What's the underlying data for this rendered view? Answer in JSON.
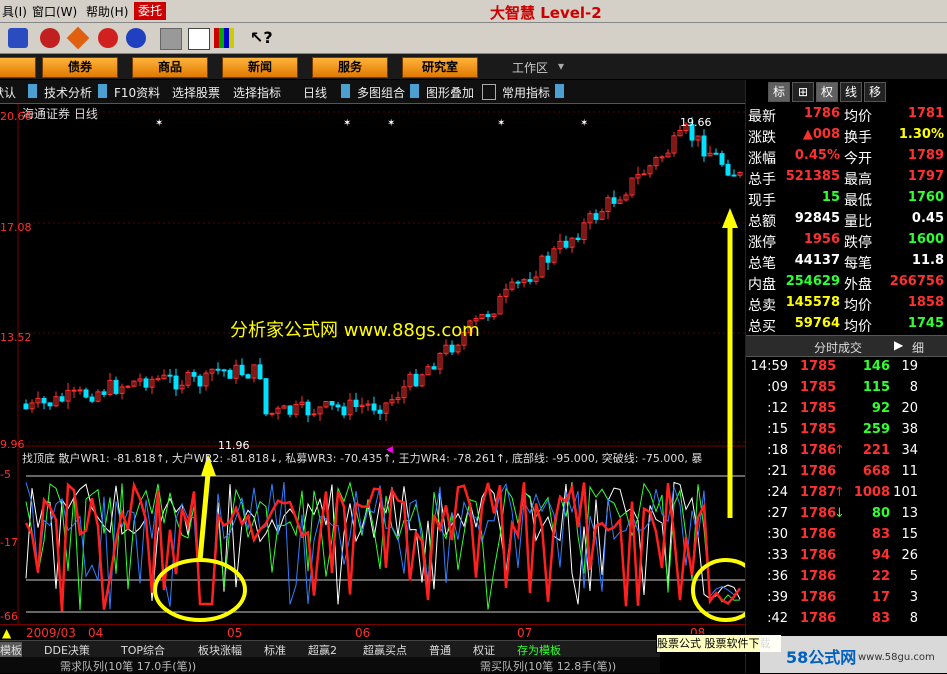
{
  "menu": {
    "items": [
      "具(I)",
      "窗口(W)",
      "帮助(H)"
    ],
    "entrust": "委托"
  },
  "brand": {
    "title": "大智慧 Level-2"
  },
  "nav": {
    "buttons": [
      "债券",
      "商品",
      "新闻",
      "服务",
      "研究室"
    ],
    "workarea": "工作区"
  },
  "funcbar": {
    "items": [
      "默认",
      "技术分析",
      "F10资料",
      "选择股票",
      "选择指标",
      "日线",
      "多图组合",
      "图形叠加",
      "常用指标"
    ]
  },
  "chart": {
    "header": "海通证券 日线",
    "price_levels": [
      "20.66",
      "17.08",
      "13.52",
      "9.96"
    ],
    "high_label": "19.66",
    "low_label": "11.96",
    "watermark": "分析家公式网 www.88gs.com",
    "indicator_line": "找顶底 散户WR1: -81.818↑, 大户WR2: -81.818↓, 私募WR3: -70.435↑, 王力WR4: -78.261↑, 底部线: -95.000, 突破线: -75.000, 暴",
    "indicator_levels": [
      "-5",
      "-17",
      "-66"
    ],
    "date_labels": [
      "2009/03",
      "04",
      "05",
      "06",
      "07",
      "08"
    ]
  },
  "chart_data": {
    "type": "line",
    "title": "海通证券 日线",
    "price_high": 19.66,
    "price_low": 11.96,
    "indicator_params": {
      "WR1": -81.818,
      "WR2": -81.818,
      "WR3": -70.435,
      "WR4": -78.261,
      "bottom_line": -95.0,
      "breakout_line": -75.0
    }
  },
  "right_panel": {
    "tabs": [
      "标",
      "⊞",
      "权",
      "线",
      "移"
    ],
    "quotes": [
      {
        "k1": "最新",
        "v1": "1786",
        "k2": "均价",
        "v2": "1781"
      },
      {
        "k1": "涨跌",
        "v1": "▲008",
        "k2": "换手",
        "v2": "1.30%"
      },
      {
        "k1": "涨幅",
        "v1": "0.45%",
        "k2": "今开",
        "v2": "1789"
      },
      {
        "k1": "总手",
        "v1": "521385",
        "k2": "最高",
        "v2": "1797"
      },
      {
        "k1": "现手",
        "v1": "15",
        "k2": "最低",
        "v2": "1760"
      },
      {
        "k1": "总额",
        "v1": "92845",
        "k2": "量比",
        "v2": "0.45"
      },
      {
        "k1": "涨停",
        "v1": "1956",
        "k2": "跌停",
        "v2": "1600"
      },
      {
        "k1": "总笔",
        "v1": "44137",
        "k2": "每笔",
        "v2": "11.8"
      },
      {
        "k1": "内盘",
        "v1": "254629",
        "k2": "外盘",
        "v2": "266756"
      },
      {
        "k1": "总卖",
        "v1": "145578",
        "k2": "均价",
        "v2": "1858"
      },
      {
        "k1": "总买",
        "v1": "59764",
        "k2": "均价",
        "v2": "1745"
      }
    ],
    "ticks_title": "分时成交",
    "ticks_detail": "细",
    "ticks": [
      {
        "t": "14:59",
        "p": "1785",
        "arr": "",
        "v": "146",
        "n": "19"
      },
      {
        "t": ":09",
        "p": "1785",
        "arr": "",
        "v": "115",
        "n": "8"
      },
      {
        "t": ":12",
        "p": "1785",
        "arr": "",
        "v": "92",
        "n": "20"
      },
      {
        "t": ":15",
        "p": "1785",
        "arr": "",
        "v": "259",
        "n": "38"
      },
      {
        "t": ":18",
        "p": "1786",
        "arr": "↑",
        "v": "221",
        "n": "34"
      },
      {
        "t": ":21",
        "p": "1786",
        "arr": "",
        "v": "668",
        "n": "11"
      },
      {
        "t": ":24",
        "p": "1787",
        "arr": "↑",
        "v": "1008",
        "n": "101"
      },
      {
        "t": ":27",
        "p": "1786",
        "arr": "↓",
        "v": "80",
        "n": "13"
      },
      {
        "t": ":30",
        "p": "1786",
        "arr": "",
        "v": "83",
        "n": "15"
      },
      {
        "t": ":33",
        "p": "1786",
        "arr": "",
        "v": "94",
        "n": "26"
      },
      {
        "t": ":36",
        "p": "1786",
        "arr": "",
        "v": "22",
        "n": "5"
      },
      {
        "t": ":39",
        "p": "1786",
        "arr": "",
        "v": "17",
        "n": "3"
      },
      {
        "t": ":42",
        "p": "1786",
        "arr": "",
        "v": "83",
        "n": "8"
      }
    ]
  },
  "bottom_tabs": [
    "模板",
    "DDE决策",
    "TOP综合",
    "板块涨幅",
    "标准",
    "超赢2",
    "超赢买点",
    "普通",
    "权证",
    "存为模板"
  ],
  "status": {
    "left": "需求队列(10笔 17.0手(笔))",
    "mid": "需买队列(10笔 12.8手(笔))"
  },
  "promo": {
    "text": "股票公式 股票软件下载",
    "site": "58公式网",
    "url": "www.58gu.com"
  },
  "colors": {
    "up": "#ff3030",
    "down": "#00e0ff",
    "yellow": "#ffff00",
    "green": "#30ff30"
  }
}
